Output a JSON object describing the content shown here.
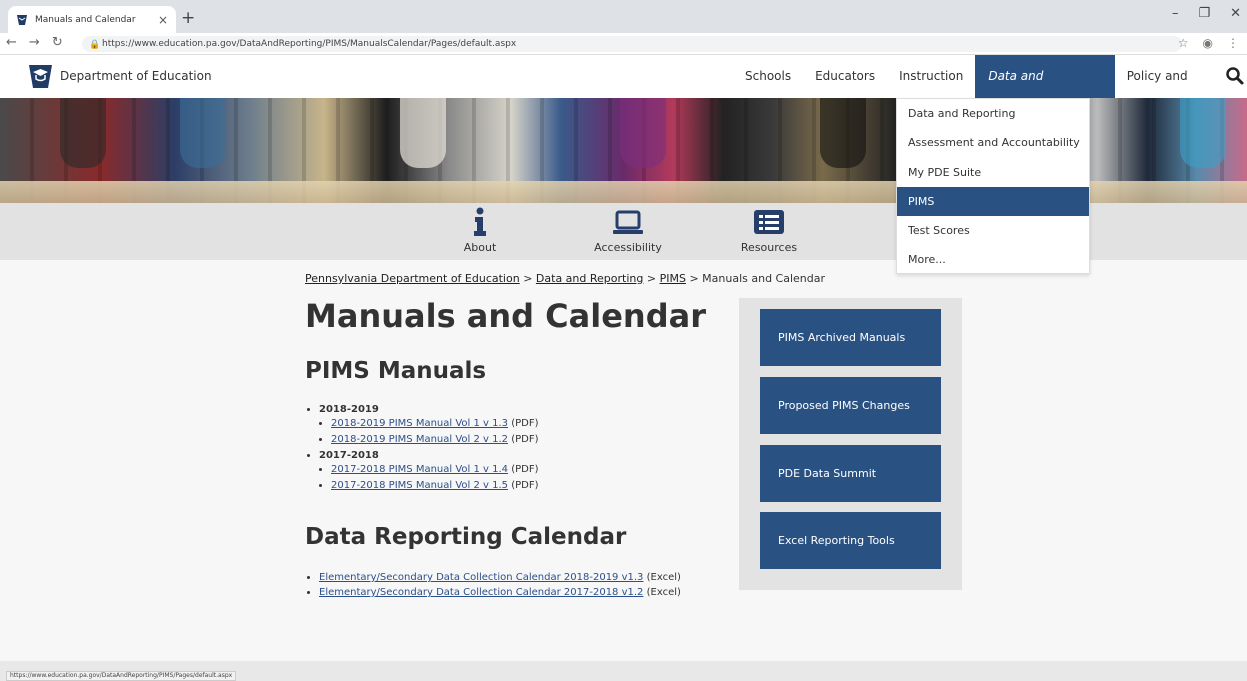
{
  "browser": {
    "tab_title": "Manuals and Calendar",
    "tab_close": "×",
    "new_tab": "+",
    "url": "https://www.education.pa.gov/DataAndReporting/PIMS/ManualsCalendar/Pages/default.aspx",
    "win_min": "–",
    "win_restore": "❐",
    "win_close": "✕"
  },
  "header": {
    "site_name": "Department of Education",
    "nav": [
      "Schools",
      "Educators",
      "Instruction",
      "Data and Reporting",
      "Policy and Funding"
    ]
  },
  "dropdown": {
    "items": [
      "Data and Reporting",
      "Assessment and Accountability",
      "My PDE Suite",
      "PIMS",
      "Test Scores",
      "More..."
    ]
  },
  "iconbar": {
    "about": "About",
    "accessibility": "Accessibility",
    "resources": "Resources"
  },
  "breadcrumb": {
    "crumb1": "Pennsylvania Department of Education",
    "sep": ">",
    "crumb2": "Data and Reporting",
    "crumb3": "PIMS",
    "current": "Manuals and Calendar"
  },
  "main": {
    "title": "Manuals and Calendar",
    "manuals_heading": "PIMS Manuals",
    "years": [
      {
        "year": "2018-2019",
        "links": [
          {
            "text": "2018-2019 PIMS Manual Vol 1 v 1.3",
            "type": "(PDF)"
          },
          {
            "text": "2018-2019 PIMS Manual Vol 2 v 1.2",
            "type": "(PDF)"
          }
        ]
      },
      {
        "year": "2017-2018",
        "links": [
          {
            "text": "2017-2018 PIMS Manual Vol 1 v 1.4",
            "type": "(PDF)"
          },
          {
            "text": "2017-2018 PIMS Manual Vol 2 v 1.5",
            "type": "(PDF)"
          }
        ]
      }
    ],
    "calendar_heading": "Data Reporting Calendar",
    "calendar_links": [
      {
        "text": "Elementary/Secondary Data Collection Calendar 2018-2019 v1.3",
        "type": "(Excel)"
      },
      {
        "text": "Elementary/Secondary Data Collection Calendar 2017-2018 v1.2",
        "type": "(Excel)"
      }
    ]
  },
  "sidebar": {
    "buttons": [
      "PIMS Archived Manuals",
      "Proposed PIMS Changes",
      "PDE Data Summit",
      "Excel Reporting Tools"
    ]
  },
  "status_bar": "https://www.education.pa.gov/DataAndReporting/PIMS/Pages/default.aspx",
  "colors": {
    "brand_blue": "#295283",
    "link": "#2b4f8a"
  }
}
